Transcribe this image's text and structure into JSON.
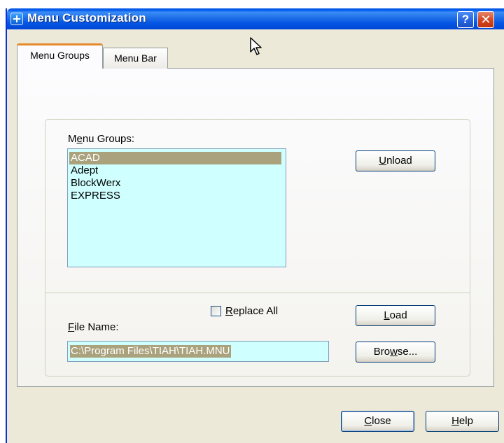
{
  "window": {
    "title": "Menu Customization",
    "help_glyph": "?",
    "close_glyph": "✕"
  },
  "tabs": [
    {
      "label": "Menu Groups",
      "active": true
    },
    {
      "label": "Menu Bar",
      "active": false
    }
  ],
  "menu_groups": {
    "label_pre": "M",
    "label_ul": "e",
    "label_post": "nu Groups:",
    "items": [
      "ACAD",
      "Adept",
      "BlockWerx",
      "EXPRESS"
    ],
    "selected": "ACAD"
  },
  "buttons": {
    "unload": {
      "ul": "U",
      "rest": "nload"
    },
    "load": {
      "ul": "L",
      "rest": "oad"
    },
    "browse": {
      "pre": "Bro",
      "ul": "w",
      "post": "se..."
    },
    "close": {
      "ul": "C",
      "rest": "lose"
    },
    "help": {
      "ul": "H",
      "rest": "elp"
    }
  },
  "replace_all": {
    "ul": "R",
    "rest": "eplace All",
    "checked": false
  },
  "file_name": {
    "ul": "F",
    "rest": "ile Name:",
    "value": "C:\\Program Files\\TIAH\\TIAH.MNU"
  },
  "icons": {
    "app": "menu-app-icon",
    "cursor": "mouse-pointer-icon"
  },
  "colors": {
    "selection": "#a9a27d",
    "list_bg": "#cfffff",
    "face": "#ece9d8",
    "title": "#0456e4"
  }
}
